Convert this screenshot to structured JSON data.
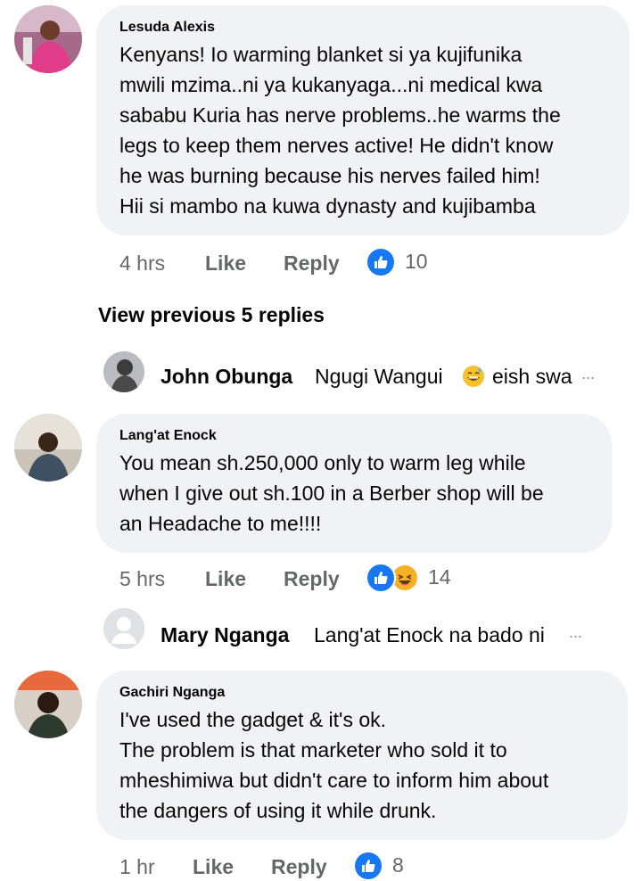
{
  "comments": [
    {
      "author": "Lesuda Alexis",
      "lines": [
        "Kenyans! Io warming blanket si ya kujifunika",
        "mwili mzima..ni ya kukanyaga...ni medical kwa",
        "sababu Kuria has nerve problems..he warms the",
        "legs to keep them nerves active! He didn't know",
        "he was burning because his nerves failed him!",
        "Hii si mambo na kuwa dynasty and kujibamba"
      ],
      "time": "4 hrs",
      "like_label": "Like",
      "reply_label": "Reply",
      "reaction_count": "10",
      "reactions": [
        "like"
      ]
    },
    {
      "author": "Lang'at Enock",
      "lines": [
        "You mean sh.250,000 only to warm leg while",
        "when I give out sh.100 in a Berber shop will be",
        "an Headache to me!!!!"
      ],
      "time": "5 hrs",
      "like_label": "Like",
      "reply_label": "Reply",
      "reaction_count": "14",
      "reactions": [
        "like",
        "haha"
      ]
    },
    {
      "author": "Gachiri Nganga",
      "lines": [
        "I've used the gadget & it's ok.",
        "The problem is that marketer who sold it to",
        "mheshimiwa but didn't care to inform him about",
        "the dangers of using it while drunk."
      ],
      "time": "1 hr",
      "like_label": "Like",
      "reply_label": "Reply",
      "reaction_count": "8",
      "reactions": [
        "like"
      ]
    }
  ],
  "view_previous": "View previous 5 replies",
  "replies": [
    {
      "name": "John Obunga",
      "text_before": "Ngugi Wangui",
      "emoji": "grinning-sweat-emoji",
      "text_after": "eish swa",
      "ellipsis": "..."
    },
    {
      "name": "Mary Nganga",
      "text_before": "Lang'at Enock na bado ni",
      "ellipsis": "..."
    }
  ],
  "colors": {
    "bubble_bg": "#f0f2f5",
    "meta_text": "#65676b",
    "like_blue": "#1877f2",
    "haha_yellow": "#f7b125"
  }
}
